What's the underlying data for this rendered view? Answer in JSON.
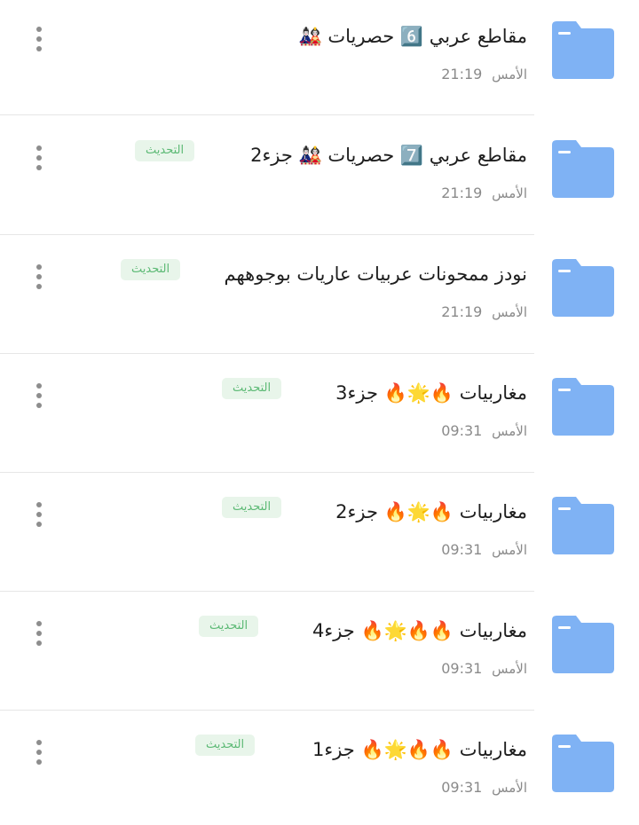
{
  "folders": [
    {
      "name": "مقاطع عربي 6️⃣ حصريات 🎎",
      "date_label": "الأمس",
      "time": "21:19",
      "badge": ""
    },
    {
      "name": "مقاطع عربي 7️⃣ حصريات 🎎 جزء2",
      "date_label": "الأمس",
      "time": "21:19",
      "badge": "التحديث"
    },
    {
      "name": "نودز ممحونات عربيات عاريات بوجوههم",
      "date_label": "الأمس",
      "time": "21:19",
      "badge": "التحديث"
    },
    {
      "name": "مغاربيات 🔥🌟🔥 جزء3",
      "date_label": "الأمس",
      "time": "09:31",
      "badge": "التحديث"
    },
    {
      "name": "مغاربيات 🔥🌟🔥 جزء2",
      "date_label": "الأمس",
      "time": "09:31",
      "badge": "التحديث"
    },
    {
      "name": "مغاربيات 🔥🔥🌟🔥 جزء4",
      "date_label": "الأمس",
      "time": "09:31",
      "badge": "التحديث"
    },
    {
      "name": "مغاربيات 🔥🔥🌟🔥 جزء1",
      "date_label": "الأمس",
      "time": "09:31",
      "badge": "التحديث"
    }
  ],
  "colors": {
    "folder": "#7fb2f4",
    "folder_tab": "#ffffff",
    "badge_bg": "#e8f5ea",
    "badge_text": "#5bb974",
    "divider": "#e6e6e6"
  },
  "icons": {
    "folder": "folder-icon",
    "more": "more-vertical-icon"
  }
}
